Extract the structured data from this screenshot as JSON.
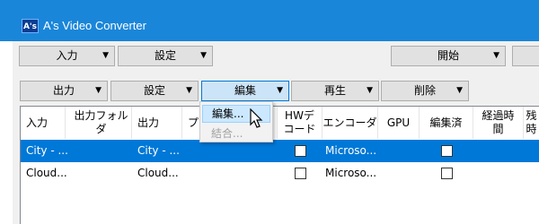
{
  "window": {
    "title": "A's Video Converter",
    "icon_text": "A's"
  },
  "toolbar1": {
    "input_label": "入力",
    "settings_label": "設定",
    "start_label": "開始"
  },
  "toolbar2": {
    "output_label": "出力",
    "settings_label": "設定",
    "edit_label": "編集",
    "play_label": "再生",
    "delete_label": "削除"
  },
  "edit_menu": {
    "items": [
      {
        "label": "編集...",
        "state": "highlighted"
      },
      {
        "label": "結合...",
        "state": "disabled"
      }
    ]
  },
  "table": {
    "headers": [
      "入力",
      "出力フォルダ",
      "出力",
      "プリセ",
      "HWデ\nコード",
      "エンコーダ",
      "GPU",
      "編集済",
      "経過時\n間",
      "残\n時"
    ],
    "rows": [
      {
        "input": "City - ...",
        "output_folder": "",
        "output": "City - ...",
        "preset": "",
        "hw_decode": false,
        "encoder": "Microso...",
        "gpu": "",
        "edited": false,
        "selected": true
      },
      {
        "input": "Cloud...",
        "output_folder": "",
        "output": "Cloud...",
        "preset": "",
        "hw_decode": false,
        "encoder": "Microso...",
        "gpu": "",
        "edited": false,
        "selected": false
      }
    ]
  },
  "colors": {
    "titlebar": "#1a86d9",
    "selection": "#0078d7",
    "menu_highlight": "#cce8ff"
  },
  "icons": {
    "dropdown": "chevron-down-icon",
    "cursor": "mouse-pointer-icon",
    "app": "app-logo-icon"
  }
}
